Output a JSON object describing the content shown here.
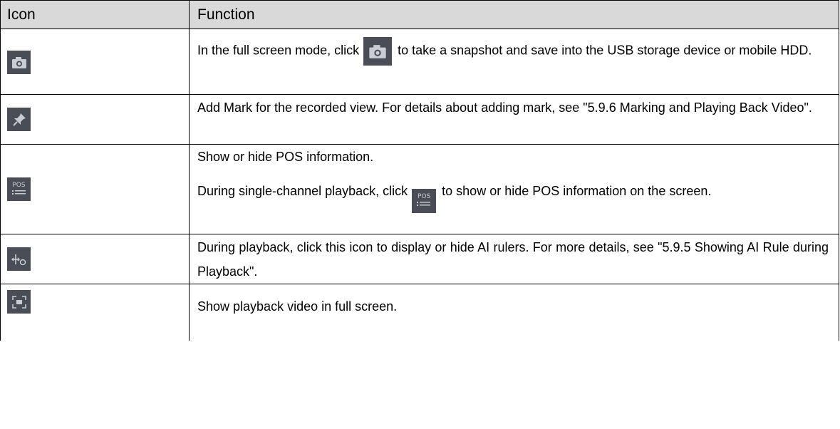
{
  "table": {
    "headers": {
      "icon": "Icon",
      "function": "Function"
    },
    "rows": [
      {
        "icon": "camera-icon",
        "text_before": "In the full screen mode, click",
        "inline_icon": "camera-icon",
        "text_after": "to take a snapshot and save into the USB storage device or mobile HDD."
      },
      {
        "icon": "pin-icon",
        "text": "Add Mark for the recorded view. For details about adding mark, see \"5.9.6 Marking and Playing Back Video\"."
      },
      {
        "icon": "pos-icon",
        "icon_label": "POS",
        "line1": "Show or hide POS information.",
        "text_before": "During single-channel playback, click",
        "inline_icon": "pos-icon",
        "text_after": "to show or hide POS information on the screen."
      },
      {
        "icon": "ai-ruler-icon",
        "text": "During playback, click this icon to display or hide AI rulers. For more details, see \"5.9.5 Showing AI Rule during Playback\"."
      },
      {
        "icon": "fullscreen-icon",
        "text": "Show playback video in full screen."
      }
    ]
  },
  "colors": {
    "header_bg": "#d9d9d9",
    "icon_bg": "#4a4d55",
    "icon_fg": "#c9ccd2"
  }
}
